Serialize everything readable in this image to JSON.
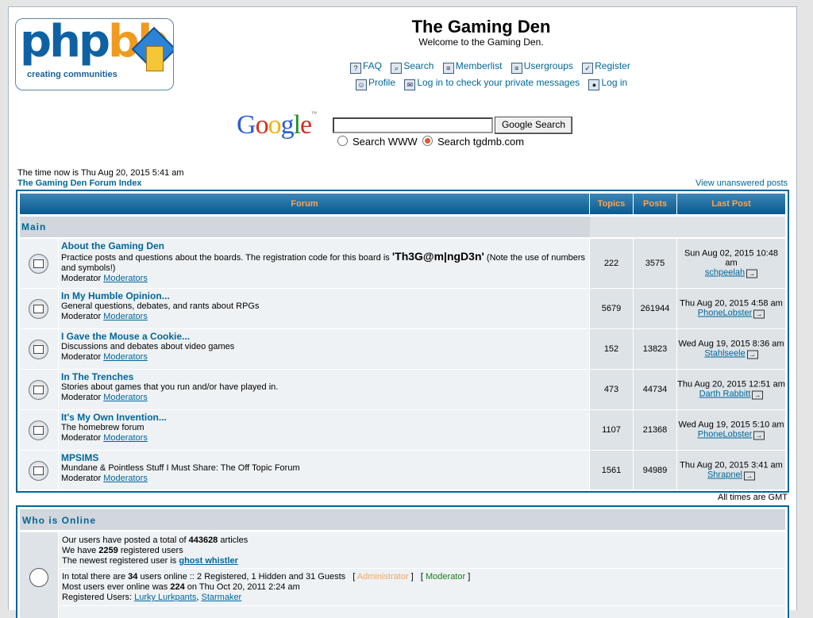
{
  "header": {
    "logo_text": "phpbb",
    "logo_tagline": "creating communities",
    "site_name": "The Gaming Den",
    "site_desc": "Welcome to the Gaming Den.",
    "nav_row1": [
      {
        "label": "FAQ",
        "icon": "faq-icon"
      },
      {
        "label": "Search",
        "icon": "search-icon"
      },
      {
        "label": "Memberlist",
        "icon": "memberlist-icon"
      },
      {
        "label": "Usergroups",
        "icon": "usergroups-icon"
      },
      {
        "label": "Register",
        "icon": "register-icon"
      }
    ],
    "nav_row2": [
      {
        "label": "Profile",
        "icon": "profile-icon"
      },
      {
        "label": "Log in to check your private messages",
        "icon": "messages-icon"
      },
      {
        "label": "Log in",
        "icon": "login-icon"
      }
    ]
  },
  "google": {
    "logo": "Google",
    "button": "Google Search",
    "query": "",
    "radio_www": "Search WWW",
    "radio_site": "Search tgdmb.com",
    "selected": "site"
  },
  "time_now": "The time now is Thu Aug 20, 2015 5:41 am",
  "breadcrumb": "The Gaming Den Forum Index",
  "view_unanswered": "View unanswered posts",
  "table": {
    "headers": {
      "forum": "Forum",
      "topics": "Topics",
      "posts": "Posts",
      "last_post": "Last Post"
    },
    "category": "Main",
    "moderator_label": "Moderator",
    "moderator_link": "Moderators",
    "forums": [
      {
        "name": "About the Gaming Den",
        "desc_pre": "Practice posts and questions about the boards. The registration code for this board is ",
        "desc_code": "'Th3G@m|ngD3n'",
        "desc_post": " (Note the use of numbers and symbols!)",
        "topics": "222",
        "posts": "3575",
        "last_date": "Sun Aug 02, 2015 10:48 am",
        "last_user": "schpeelah"
      },
      {
        "name": "In My Humble Opinion...",
        "desc_pre": "General questions, debates, and rants about RPGs",
        "desc_code": "",
        "desc_post": "",
        "topics": "5679",
        "posts": "261944",
        "last_date": "Thu Aug 20, 2015 4:58 am",
        "last_user": "PhoneLobster"
      },
      {
        "name": "I Gave the Mouse a Cookie...",
        "desc_pre": "Discussions and debates about video games",
        "desc_code": "",
        "desc_post": "",
        "topics": "152",
        "posts": "13823",
        "last_date": "Wed Aug 19, 2015 8:36 am",
        "last_user": "Stahlseele"
      },
      {
        "name": "In The Trenches",
        "desc_pre": "Stories about games that you run and/or have played in.",
        "desc_code": "",
        "desc_post": "",
        "topics": "473",
        "posts": "44734",
        "last_date": "Thu Aug 20, 2015 12:51 am",
        "last_user": "Darth Rabbitt"
      },
      {
        "name": "It's My Own Invention...",
        "desc_pre": "The homebrew forum",
        "desc_code": "",
        "desc_post": "",
        "topics": "1107",
        "posts": "21368",
        "last_date": "Wed Aug 19, 2015 5:10 am",
        "last_user": "PhoneLobster"
      },
      {
        "name": "MPSIMS",
        "desc_pre": "Mundane & Pointless Stuff I Must Share: The Off Topic Forum",
        "desc_code": "",
        "desc_post": "",
        "topics": "1561",
        "posts": "94989",
        "last_date": "Thu Aug 20, 2015 3:41 am",
        "last_user": "Shrapnel"
      }
    ]
  },
  "all_times": "All times are GMT",
  "online": {
    "title": "Who is Online",
    "posted_pre": "Our users have posted a total of ",
    "posted_count": "443628",
    "posted_post": " articles",
    "registered_pre": "We have ",
    "registered_count": "2259",
    "registered_post": " registered users",
    "newest_pre": "The newest registered user is ",
    "newest_user": "ghost whistler",
    "total_pre": "In total there are ",
    "total_count": "34",
    "total_post": " users online :: 2 Registered, 1 Hidden and 31 Guests   [",
    "admin_label": " Administrator ",
    "mid_bracket": "]   [",
    "mod_label": " Moderator ",
    "end_bracket": "]",
    "most_pre": "Most users ever online was ",
    "most_count": "224",
    "most_post": " on Thu Oct 20, 2011 2:24 am",
    "reg_users_label": "Registered Users: ",
    "reg_user_1": "Lurky Lurkpants",
    "reg_user_2": "Starmaker"
  }
}
